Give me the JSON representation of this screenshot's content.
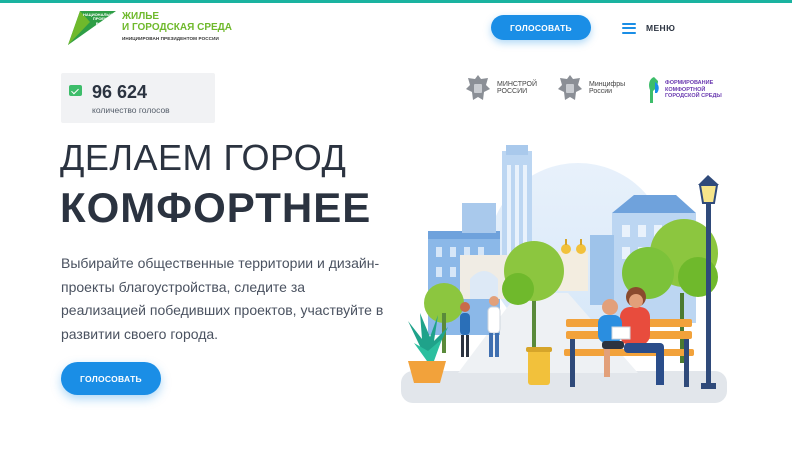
{
  "header": {
    "logo_small": "НАЦИОНАЛЬНЫЕ ПРОЕКТЫ РОССИИ",
    "logo_title": "ЖИЛЬЕ\nИ ГОРОДСКАЯ СРЕДА",
    "logo_subtitle": "ИНИЦИИРОВАН ПРЕЗИДЕНТОМ РОССИИ",
    "vote_button": "ГОЛОСОВАТЬ",
    "menu_label": "МЕНЮ"
  },
  "counter": {
    "value": "96 624",
    "label": "количество голосов"
  },
  "partners": [
    {
      "name": "МИНСТРОЙ\nРОССИИ",
      "icon": "emblem-icon"
    },
    {
      "name": "Минцифры\nРоссии",
      "icon": "emblem-icon"
    },
    {
      "name": "ФОРМИРОВАНИЕ\nКОМФОРТНОЙ\nГОРОДСКОЙ СРЕДЫ",
      "icon": "fks-logo-icon"
    }
  ],
  "hero": {
    "title_line1": "ДЕЛАЕМ ГОРОД",
    "title_line2": "КОМФОРТНЕЕ",
    "description": "Выбирайте общественные территории и дизайн-проекты благоустройства, следите за реализацией победивших проектов, участвуйте в развитии своего города.",
    "vote_button": "ГОЛОСОВАТЬ"
  },
  "colors": {
    "accent_blue": "#1a8ee6",
    "brand_green": "#6fb92c",
    "top_line": "#1ab3a0",
    "text_dark": "#2b3340"
  }
}
